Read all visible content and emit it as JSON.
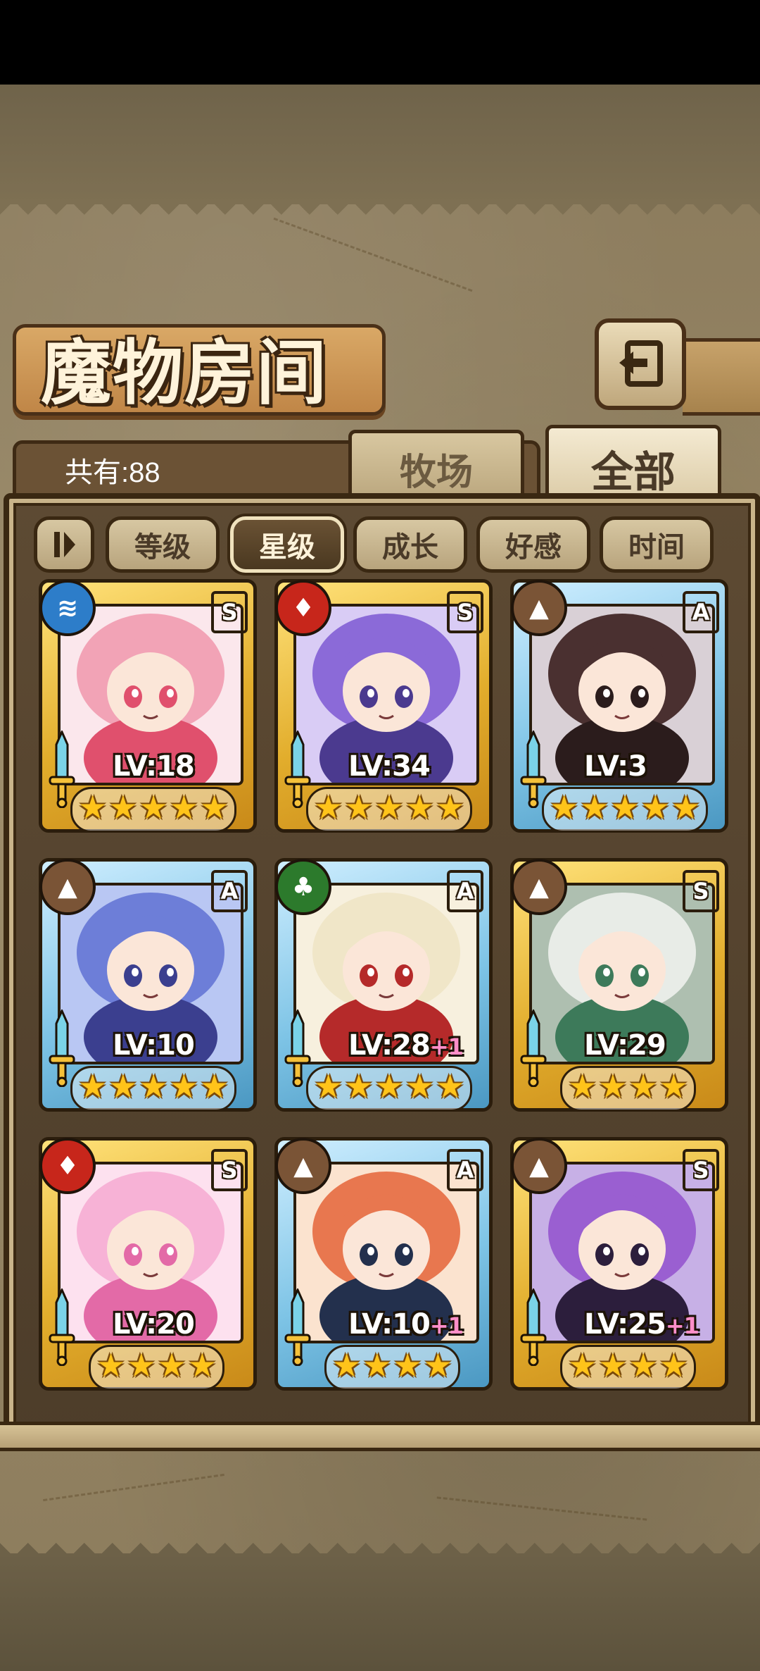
{
  "header": {
    "title": "魔物房间",
    "back_icon": "back-arrow-icon"
  },
  "summary": {
    "count_label": "共有:88"
  },
  "tabs": [
    {
      "label": "牧场",
      "active": false
    },
    {
      "label": "全部",
      "active": true
    }
  ],
  "sort_buttons": [
    {
      "label": "等级",
      "active": false
    },
    {
      "label": "星级",
      "active": true
    },
    {
      "label": "成长",
      "active": false
    },
    {
      "label": "好感",
      "active": false
    },
    {
      "label": "时间",
      "active": false
    }
  ],
  "monsters": [
    {
      "element": "water",
      "rank": "S",
      "frame": "gold",
      "level": "LV:18",
      "bonus": "",
      "stars": 5,
      "palette": [
        "#f2a3b6",
        "#e0506d",
        "#fbe7ec"
      ]
    },
    {
      "element": "fire",
      "rank": "S",
      "frame": "gold",
      "level": "LV:34",
      "bonus": "",
      "stars": 5,
      "palette": [
        "#8b6ad8",
        "#4b3a8f",
        "#d9ccf5"
      ]
    },
    {
      "element": "earth",
      "rank": "A",
      "frame": "blue",
      "level": "LV:3",
      "bonus": "",
      "stars": 5,
      "palette": [
        "#4a3030",
        "#2b1c1c",
        "#d9d0d6"
      ]
    },
    {
      "element": "earth",
      "rank": "A",
      "frame": "blue",
      "level": "LV:10",
      "bonus": "",
      "stars": 5,
      "palette": [
        "#6d7ed8",
        "#3b3f8f",
        "#b9c7f3"
      ]
    },
    {
      "element": "wind",
      "rank": "A",
      "frame": "blue",
      "level": "LV:28",
      "bonus": "+1",
      "stars": 5,
      "palette": [
        "#f0e6c8",
        "#b52a2a",
        "#f7f0de"
      ]
    },
    {
      "element": "earth",
      "rank": "S",
      "frame": "gold",
      "level": "LV:29",
      "bonus": "",
      "stars": 4,
      "palette": [
        "#e8ece7",
        "#3d7a5a",
        "#aebfb0"
      ]
    },
    {
      "element": "fire",
      "rank": "S",
      "frame": "gold",
      "level": "LV:20",
      "bonus": "",
      "stars": 4,
      "palette": [
        "#f7b2d6",
        "#e36aa7",
        "#fde1ef"
      ]
    },
    {
      "element": "earth",
      "rank": "A",
      "frame": "blue",
      "level": "LV:10",
      "bonus": "+1",
      "stars": 4,
      "palette": [
        "#e8774f",
        "#23304d",
        "#fbe3cf"
      ]
    },
    {
      "element": "earth",
      "rank": "S",
      "frame": "gold",
      "level": "LV:25",
      "bonus": "+1",
      "stars": 4,
      "palette": [
        "#9a5fd1",
        "#2c1e3c",
        "#c7b0e6"
      ]
    }
  ]
}
